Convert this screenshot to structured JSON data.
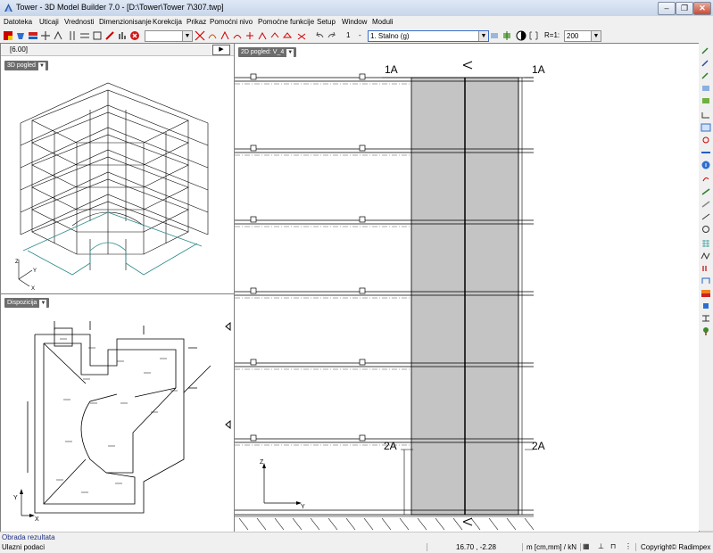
{
  "window": {
    "title": "Tower - 3D Model Builder 7.0 - [D:\\Tower\\Tower 7\\307.twp]"
  },
  "menu": [
    "Datoteka",
    "Uticaji",
    "Vrednosti",
    "Dimenzionisanje",
    "Korekcija",
    "Prikaz",
    "Pomoćni nivo",
    "Pomoćne funkcije",
    "Setup",
    "Window",
    "Moduli"
  ],
  "toolbar": {
    "layer_value": "",
    "step_label": "1",
    "load_case": "1. Stalno (g)",
    "ratio_label": "R=1:",
    "ratio_value": "200"
  },
  "view3d": {
    "level_label": "[6.00]",
    "tab_label": "3D pogled"
  },
  "view2d": {
    "tab_label": "2D pogled: V_4",
    "section_top_left": "1A",
    "section_top_right": "1A",
    "section_bottom_left": "2A",
    "section_bottom_right": "2A",
    "axis_z": "Z",
    "axis_y": "Y"
  },
  "plan": {
    "tab_label": "Dispozicija",
    "axis_y": "Y",
    "axis_x": "X"
  },
  "status": {
    "mode": "Obrada rezultata",
    "hint": "Ulazni podaci",
    "coords": "16.70 , -2.28",
    "units": "m [cm,mm] / kN",
    "copyright": "Copyright© Radimpex"
  }
}
